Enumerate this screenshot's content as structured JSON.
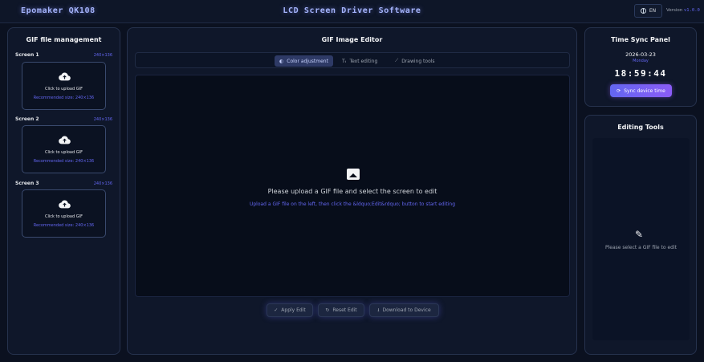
{
  "header": {
    "brand": "Epomaker QK108",
    "title": "LCD Screen Driver Software",
    "lang": "EN",
    "version_label": "Version",
    "version_number": "v1.0.0",
    "icons": {
      "lang": "globe-icon"
    }
  },
  "left": {
    "title": "GIF file management",
    "screens": [
      {
        "label": "Screen 1",
        "size": "240×136",
        "upload_text": "Click to upload GIF",
        "hint": "Recommended size: 240×136"
      },
      {
        "label": "Screen 2",
        "size": "240×136",
        "upload_text": "Click to upload GIF",
        "hint": "Recommended size: 240×136"
      },
      {
        "label": "Screen 3",
        "size": "240×136",
        "upload_text": "Click to upload GIF",
        "hint": "Recommended size: 240×136"
      }
    ]
  },
  "center": {
    "title": "GIF Image Editor",
    "tabs": [
      {
        "label": "Color adjustment",
        "icon": "palette-icon",
        "active": true
      },
      {
        "label": "Text editing",
        "icon": "text-icon",
        "active": false
      },
      {
        "label": "Drawing tools",
        "icon": "brush-icon",
        "active": false
      }
    ],
    "placeholder_title": "Please upload a GIF file and select the screen to edit",
    "placeholder_sub": "Upload a GIF file on the left, then click the &ldquo;Edit&rdquo; button to start editing",
    "actions": {
      "apply": "Apply Edit",
      "reset": "Reset Edit",
      "download": "Download to Device"
    }
  },
  "time": {
    "title": "Time Sync Panel",
    "date": "2026-03-23",
    "weekday": "Monday",
    "clock": "18:59:44",
    "sync": "Sync device time"
  },
  "tools": {
    "title": "Editing Tools",
    "empty": "Please select a GIF file to edit"
  },
  "colors": {
    "accent": "#6366f1",
    "background": "#0b1120",
    "panel": "#0f172a"
  }
}
